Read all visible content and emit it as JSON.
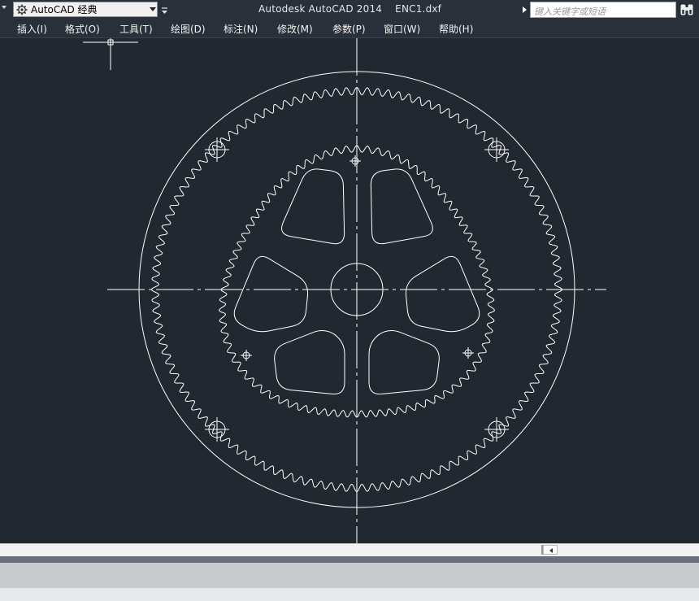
{
  "title_bar": {
    "workspace_name": "AutoCAD 经典",
    "app_title": "Autodesk AutoCAD 2014    ENC1.dxf",
    "search_placeholder": "键入关键字或短语"
  },
  "menu": {
    "items": [
      {
        "label": "插入(I)"
      },
      {
        "label": "格式(O)"
      },
      {
        "label": "工具(T)"
      },
      {
        "label": "绘图(D)"
      },
      {
        "label": "标注(N)"
      },
      {
        "label": "修改(M)"
      },
      {
        "label": "参数(P)"
      },
      {
        "label": "窗口(W)"
      },
      {
        "label": "帮助(H)"
      }
    ]
  },
  "colors": {
    "canvas_bg": "#212830",
    "linework": "#ffffff",
    "title_bg": "#2a303a"
  },
  "drawing": {
    "file": "ENC1.dxf",
    "outer_gear_teeth": 120,
    "inner_gear_teeth": 84,
    "spoke_openings": 6
  },
  "icons": {
    "workspace_icon": "gear-icon",
    "search_icon": "binoculars-icon"
  }
}
